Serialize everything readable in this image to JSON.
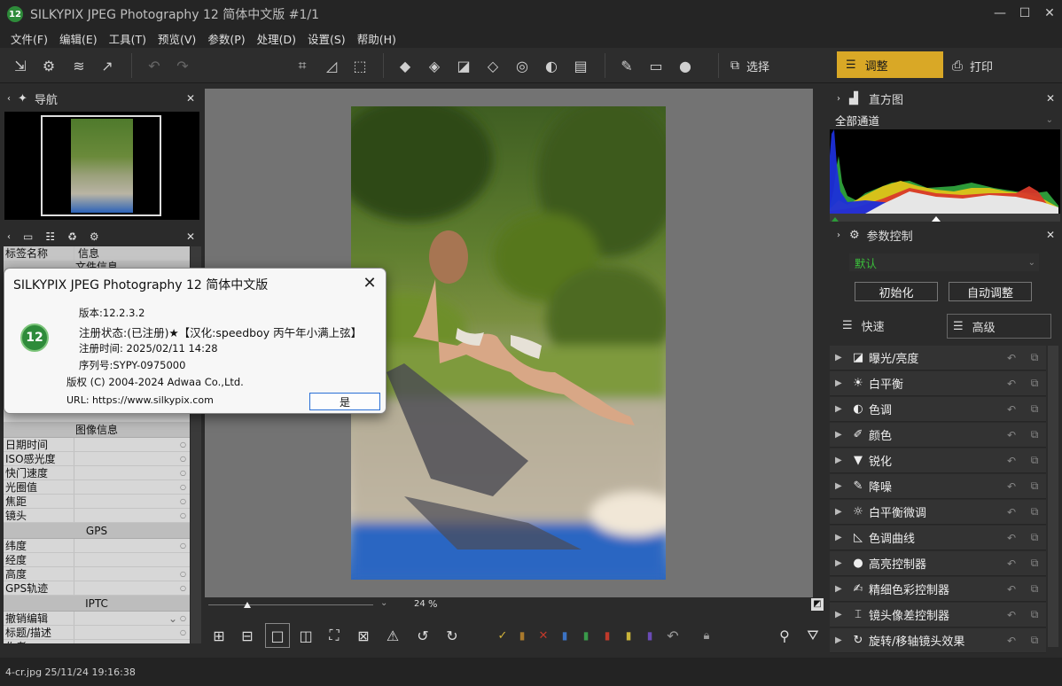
{
  "titlebar": {
    "title": "SILKYPIX JPEG Photography 12 简体中文版   #1/1",
    "logo": "12",
    "min": "—",
    "max": "☐",
    "close": "✕"
  },
  "menu": [
    "文件(F)",
    "编辑(E)",
    "工具(T)",
    "预览(V)",
    "参数(P)",
    "处理(D)",
    "设置(S)",
    "帮助(H)"
  ],
  "toolbar": {
    "select_label": "选择",
    "adjust_label": "调整",
    "print_label": "打印"
  },
  "left": {
    "nav_title": "导航",
    "meta_header": {
      "key": "标签名称",
      "value": "信息"
    },
    "file_info_section": "文件信息",
    "image_info_section": "图像信息",
    "image_info_rows": [
      "日期时间",
      "ISO感光度",
      "快门速度",
      "光圈值",
      "焦距",
      "镜头"
    ],
    "gps_section": "GPS",
    "gps_rows": [
      "纬度",
      "经度",
      "高度",
      "GPS轨迹"
    ],
    "iptc_section": "IPTC",
    "iptc_rows": [
      "撤销编辑",
      "标题/描述",
      "作者"
    ]
  },
  "zoom": {
    "value": "24",
    "unit": "%"
  },
  "status": {
    "text": "4-cr.jpg 25/11/24 19:16:38"
  },
  "right": {
    "histogram_title": "直方图",
    "channel": "全部通道",
    "param_title": "参数控制",
    "preset": "默认",
    "init_button": "初始化",
    "auto_button": "自动调整",
    "quick_label": "快速",
    "advanced_label": "高级",
    "controls": [
      "曝光/亮度",
      "白平衡",
      "色调",
      "颜色",
      "锐化",
      "降噪",
      "白平衡微调",
      "色调曲线",
      "高亮控制器",
      "精细色彩控制器",
      "镜头像差控制器",
      "旋转/移轴镜头效果"
    ]
  },
  "dialog": {
    "title": "SILKYPIX JPEG Photography 12 简体中文版",
    "logo": "12",
    "version": "版本:12.2.3.2",
    "reg_status": "注册状态:(已注册)★【汉化:speedboy 丙午年小满上弦】",
    "reg_time": "注册时间: 2025/02/11 14:28",
    "serial": "序列号:SYPY-0975000",
    "copyright": "版权 (C) 2004-2024 Adwaa Co.,Ltd.",
    "url": "URL: https://www.silkypix.com",
    "ok": "是"
  },
  "colors": {
    "accent": "#d9a826",
    "logo_green": "#2e8b3a",
    "preset_green": "#3bbf3b"
  }
}
